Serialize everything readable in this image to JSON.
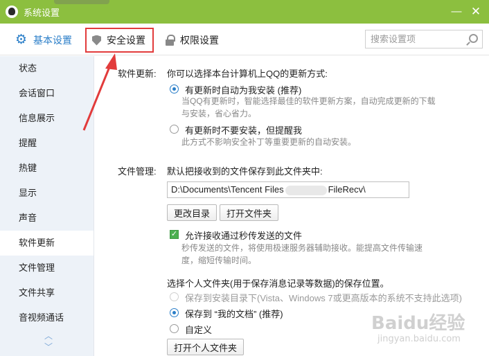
{
  "window": {
    "title": "系统设置",
    "minimize": "—",
    "close": "✕"
  },
  "header": {
    "tabs": [
      {
        "label": "基本设置",
        "icon": "gear-icon",
        "active": true
      },
      {
        "label": "安全设置",
        "icon": "shield-icon",
        "highlighted": true
      },
      {
        "label": "权限设置",
        "icon": "lock-icon"
      }
    ],
    "search": {
      "placeholder": "搜索设置项"
    }
  },
  "sidebar": {
    "items": [
      "状态",
      "会话窗口",
      "信息展示",
      "提醒",
      "热键",
      "显示",
      "声音",
      "软件更新",
      "文件管理",
      "文件共享",
      "音视频通话"
    ],
    "selected": "软件更新",
    "scroll_up": "︿",
    "scroll_down": "﹀"
  },
  "update": {
    "label": "软件更新:",
    "question": "你可以选择本台计算机上QQ的更新方式:",
    "option1": "有更新时自动为我安装 (推荐)",
    "option1_desc_line1": "当QQ有更新时，智能选择最佳的软件更新方案，自动完成更新的下载",
    "option1_desc_line2": "与安装，省心省力。",
    "option2": "有更新时不要安装，但提醒我",
    "option2_desc": "此方式不影响安全补丁等重要更新的自动安装。"
  },
  "files": {
    "label": "文件管理:",
    "question": "默认把接收到的文件保存到此文件夹中:",
    "path_start": "D:\\Documents\\Tencent Files",
    "path_end": "FileRecv\\",
    "change_dir": "更改目录",
    "open_folder": "打开文件夹",
    "allow_second": "允许接收通过秒传发送的文件",
    "allow_desc_line1": "秒传发送的文件，将使用极速服务器辅助接收。能提高文件传输速",
    "allow_desc_line2": "度，缩短传输时间。",
    "personal_title": "选择个人文件夹(用于保存消息记录等数据)的保存位置。",
    "personal_opt1": "保存到安装目录下(Vista、Windows 7或更高版本的系统不支持此选项)",
    "personal_opt2": "保存到 “我的文档” (推荐)",
    "personal_opt3": "自定义",
    "open_personal": "打开个人文件夹"
  },
  "watermark": {
    "main": "Baidu经验",
    "sub": "jingyan.baidu.com"
  },
  "colors": {
    "titlebar": "#8cbf3f",
    "accent": "#2a7ec8",
    "highlight": "#e23b3b",
    "sidebar_bg": "#edf2f8"
  }
}
